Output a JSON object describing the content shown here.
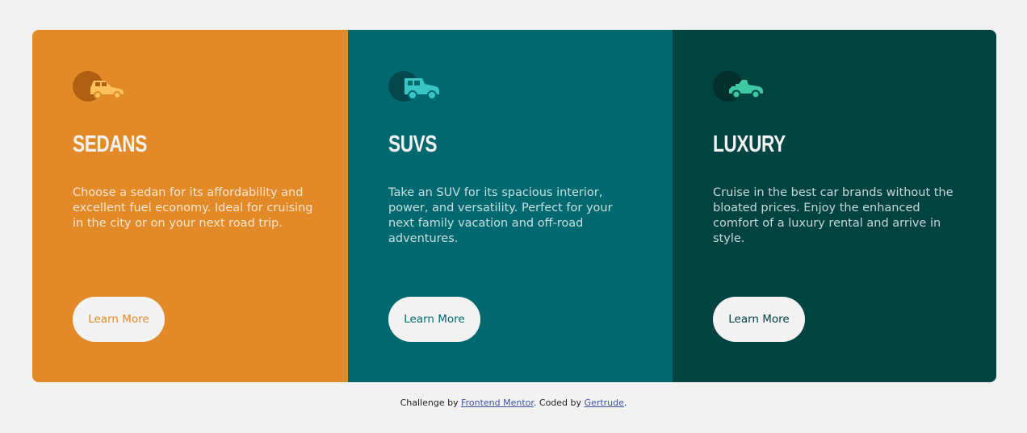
{
  "cards": [
    {
      "id": "sedans",
      "icon": "sedan-car-icon",
      "title": "Sedans",
      "description": "Choose a sedan for its affordability and excellent fuel economy. Ideal for cruising in the city or on your next road trip.",
      "button_label": "Learn More",
      "background": "#e28a28"
    },
    {
      "id": "suvs",
      "icon": "suv-car-icon",
      "title": "SUVs",
      "description": "Take an SUV for its spacious interior, power, and versatility. Perfect for your next family vacation and off-road adventures.",
      "button_label": "Learn More",
      "background": "#006970"
    },
    {
      "id": "luxury",
      "icon": "luxury-car-icon",
      "title": "Luxury",
      "description": "Cruise in the best car brands without the bloated prices. Enjoy the enhanced comfort of a luxury rental and arrive in style.",
      "button_label": "Learn More",
      "background": "#004340"
    }
  ],
  "footer": {
    "prefix": "Challenge by ",
    "link1": "Frontend Mentor",
    "middle": ". Coded by ",
    "link2": "Gertrude",
    "suffix": "."
  },
  "colors": {
    "page_bg": "#f2f2f2",
    "button_bg": "#f2f2f2",
    "footer_link": "#3e52a3"
  }
}
